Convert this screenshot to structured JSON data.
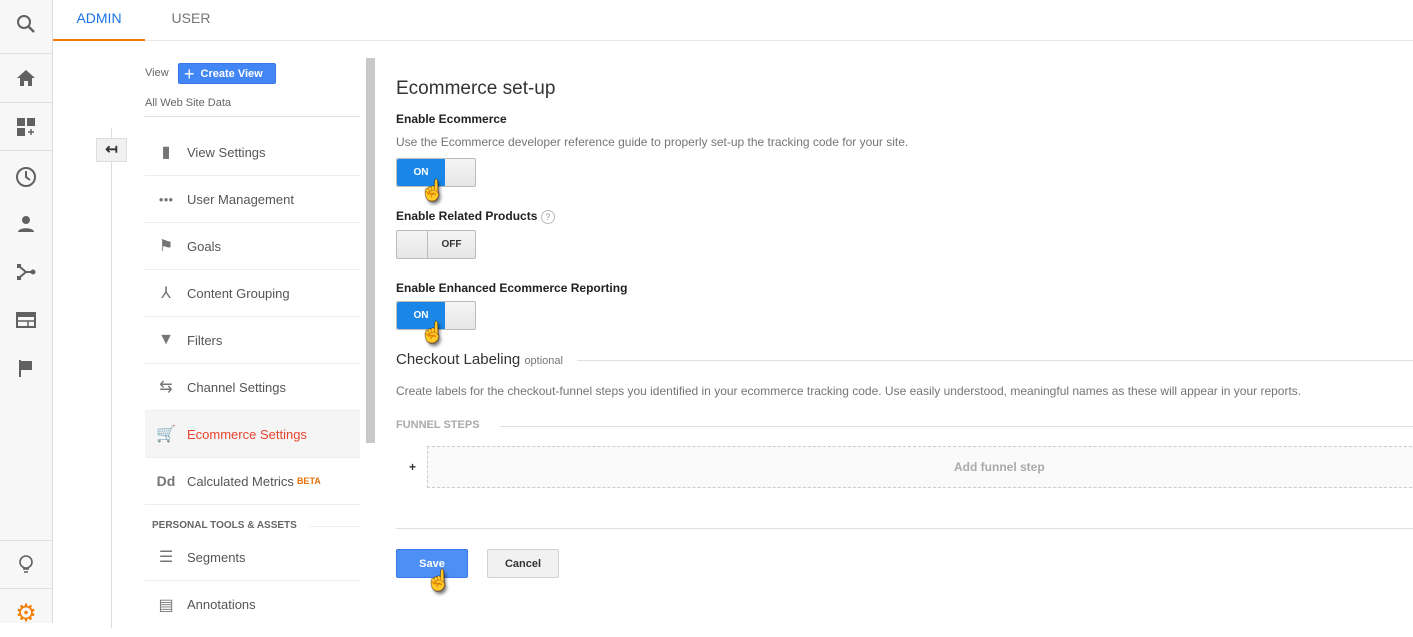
{
  "rail": {
    "items": [
      "search-icon",
      "home-icon",
      "dashboard-add-icon",
      "clock-icon",
      "person-icon",
      "branch-icon",
      "layout-icon",
      "flag-icon",
      "lightbulb-icon",
      "gear-icon"
    ]
  },
  "tabs": {
    "admin": "ADMIN",
    "user": "USER"
  },
  "view": {
    "label": "View",
    "create_button": "Create View",
    "current": "All Web Site Data"
  },
  "nav": {
    "items": [
      {
        "label": "View Settings",
        "icon": "document-icon"
      },
      {
        "label": "User Management",
        "icon": "users-icon"
      },
      {
        "label": "Goals",
        "icon": "flag-icon"
      },
      {
        "label": "Content Grouping",
        "icon": "content-grouping-icon"
      },
      {
        "label": "Filters",
        "icon": "filter-icon"
      },
      {
        "label": "Channel Settings",
        "icon": "channel-icon"
      },
      {
        "label": "Ecommerce Settings",
        "icon": "cart-icon",
        "active": true
      },
      {
        "label": "Calculated Metrics",
        "icon": "dd-icon",
        "badge": "BETA"
      }
    ],
    "section": "PERSONAL TOOLS & ASSETS",
    "section_items": [
      {
        "label": "Segments",
        "icon": "segments-icon"
      },
      {
        "label": "Annotations",
        "icon": "annotation-icon"
      }
    ],
    "dd": "Dd"
  },
  "main": {
    "title": "Ecommerce set-up",
    "enable_ecommerce": {
      "label": "Enable Ecommerce",
      "desc": "Use the Ecommerce developer reference guide to properly set-up the tracking code for your site.",
      "state": "ON"
    },
    "related": {
      "label": "Enable Related Products",
      "help": "?",
      "state": "OFF"
    },
    "enhanced": {
      "label": "Enable Enhanced Ecommerce Reporting",
      "state": "ON"
    },
    "checkout": {
      "title": "Checkout Labeling",
      "optional": "optional",
      "desc": "Create labels for the checkout-funnel steps you identified in your ecommerce tracking code. Use easily understood, meaningful names as these will appear in your reports."
    },
    "funnel": {
      "title": "FUNNEL STEPS",
      "plus": "+",
      "add": "Add funnel step"
    },
    "save": "Save",
    "cancel": "Cancel"
  },
  "colors": {
    "accent": "#1a73e8",
    "toggle_on": "#1a86e8",
    "active_nav": "#e8452c",
    "tab_underline": "#f57c00",
    "gear": "#f57c00"
  }
}
